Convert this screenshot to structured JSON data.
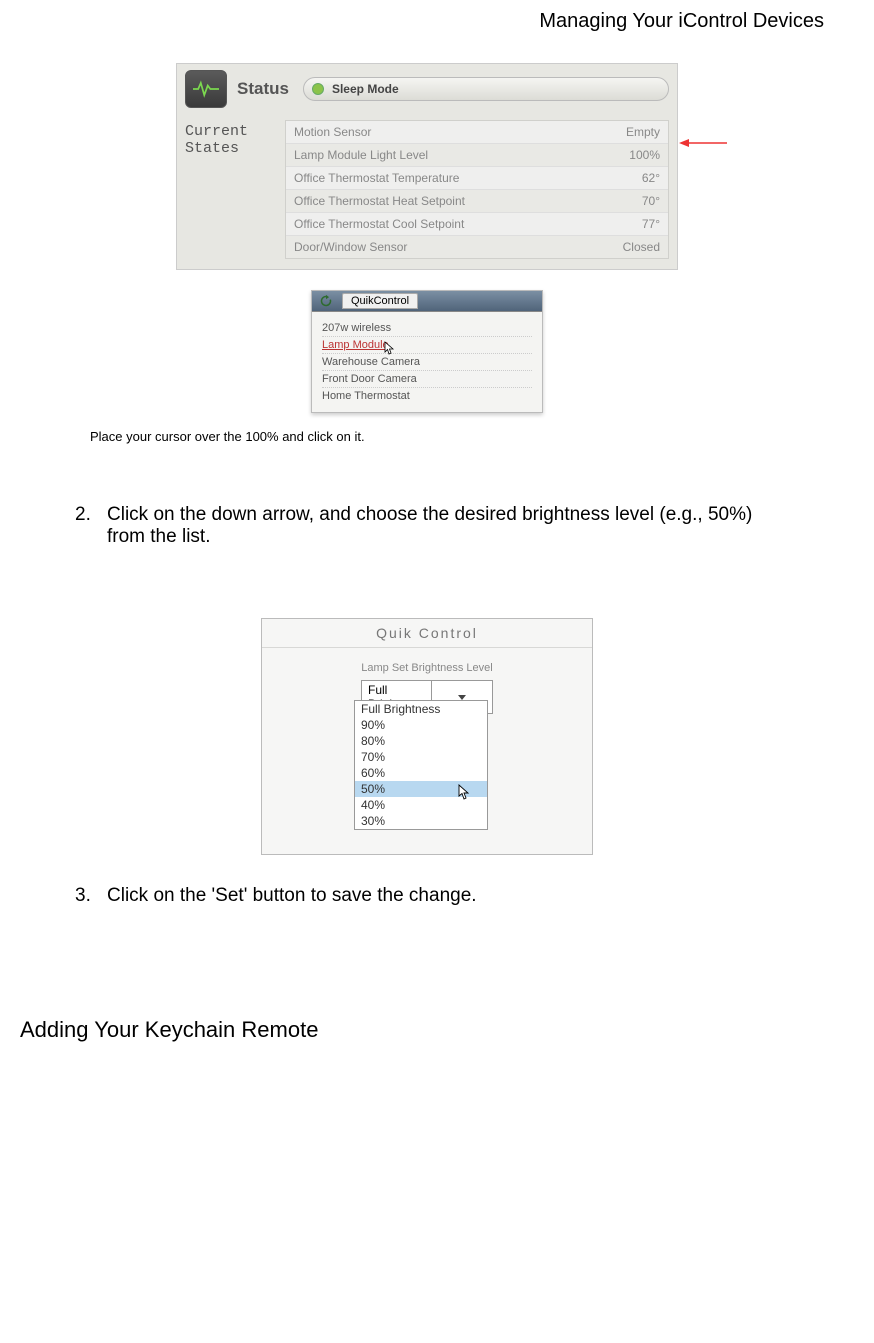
{
  "header": {
    "title": "Managing Your iControl Devices"
  },
  "status_panel": {
    "status_label": "Status",
    "mode_label": "Sleep Mode",
    "left_label_line1": "Current",
    "left_label_line2": "States",
    "rows": [
      {
        "name": "Motion Sensor",
        "value": "Empty"
      },
      {
        "name": "Lamp Module Light Level",
        "value": "100%"
      },
      {
        "name": "Office Thermostat Temperature",
        "value": "62°"
      },
      {
        "name": "Office Thermostat Heat Setpoint",
        "value": "70°"
      },
      {
        "name": "Office Thermostat Cool Setpoint",
        "value": "77°"
      },
      {
        "name": "Door/Window Sensor",
        "value": "Closed"
      }
    ]
  },
  "quikcontrol": {
    "tab_label": "QuikControl",
    "items": [
      "207w wireless",
      "Lamp Module",
      "Warehouse Camera",
      "Front Door Camera",
      "Home Thermostat"
    ],
    "selected_index": 1
  },
  "caption": "Place your cursor over the 100% and click on it.",
  "steps": {
    "s2_num": "2.",
    "s2_text": "Click on the down arrow, and choose the desired brightness level (e.g., 50%) from the list.",
    "s3_num": "3.",
    "s3_text": "Click on the 'Set' button to save the change."
  },
  "brightness": {
    "panel_title": "Quik Control",
    "field_label": "Lamp Set Brightness Level",
    "selected": "Full Brightness",
    "options": [
      "Full Brightness",
      "90%",
      "80%",
      "70%",
      "60%",
      "50%",
      "40%",
      "30%"
    ],
    "highlight_index": 5
  },
  "section_heading": "Adding Your Keychain Remote"
}
